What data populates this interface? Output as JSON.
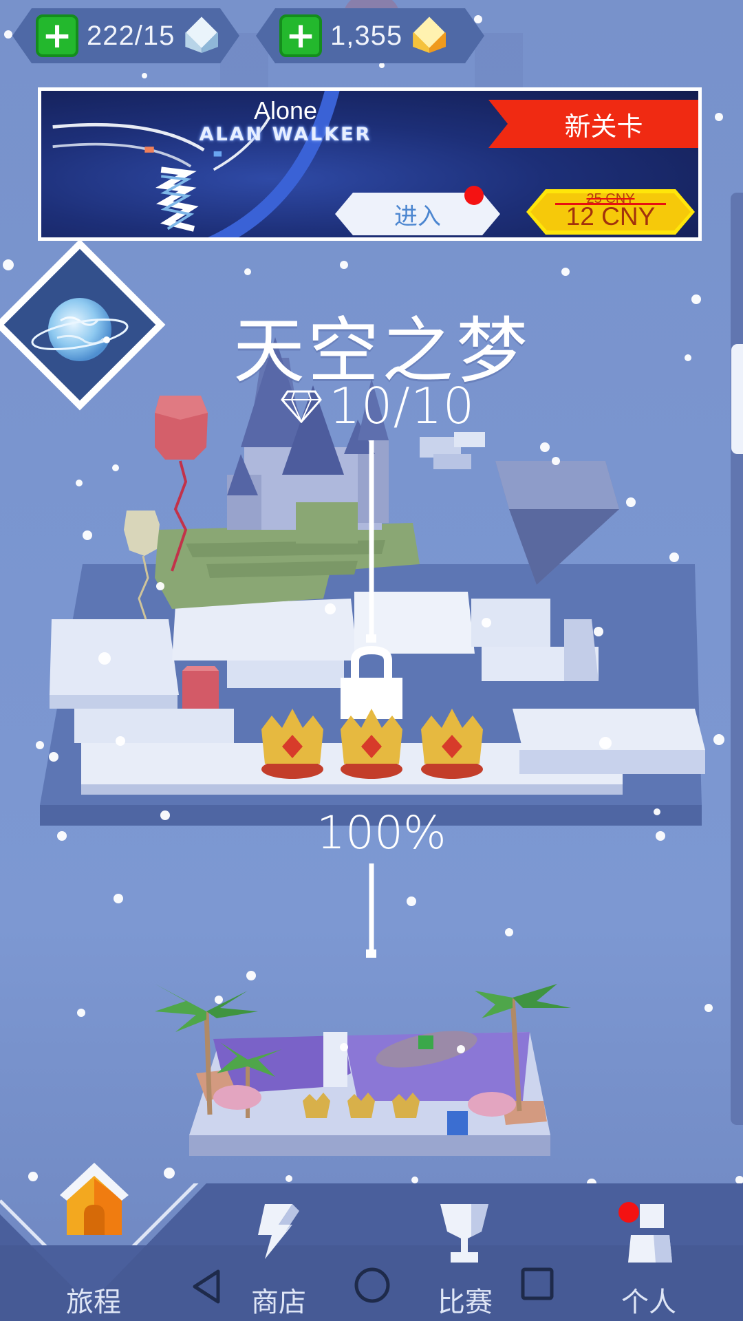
{
  "resources": {
    "lives_value": "222/15",
    "gems_value": "1,355",
    "add_symbol": "+"
  },
  "banner": {
    "song_title": "Alone",
    "artist": "ALAN WALKER",
    "ribbon_label": "新关卡",
    "enter_label": "进入",
    "price_old": "25 CNY",
    "price_new": "12 CNY"
  },
  "world": {
    "title": "天空之梦",
    "diamonds": "10/10",
    "progress": "100%",
    "crowns_earned": 3,
    "crowns_total": 3
  },
  "nav": {
    "items": [
      {
        "label": "旅程",
        "icon": "home-icon"
      },
      {
        "label": "商店",
        "icon": "shop-icon"
      },
      {
        "label": "比赛",
        "icon": "trophy-icon"
      },
      {
        "label": "个人",
        "icon": "profile-icon"
      }
    ]
  },
  "colors": {
    "background": "#7891c9",
    "plus_green": "#23b82d",
    "ribbon_red": "#f02a12",
    "price_yellow": "#f6c90a",
    "notification_red": "#f41212"
  }
}
